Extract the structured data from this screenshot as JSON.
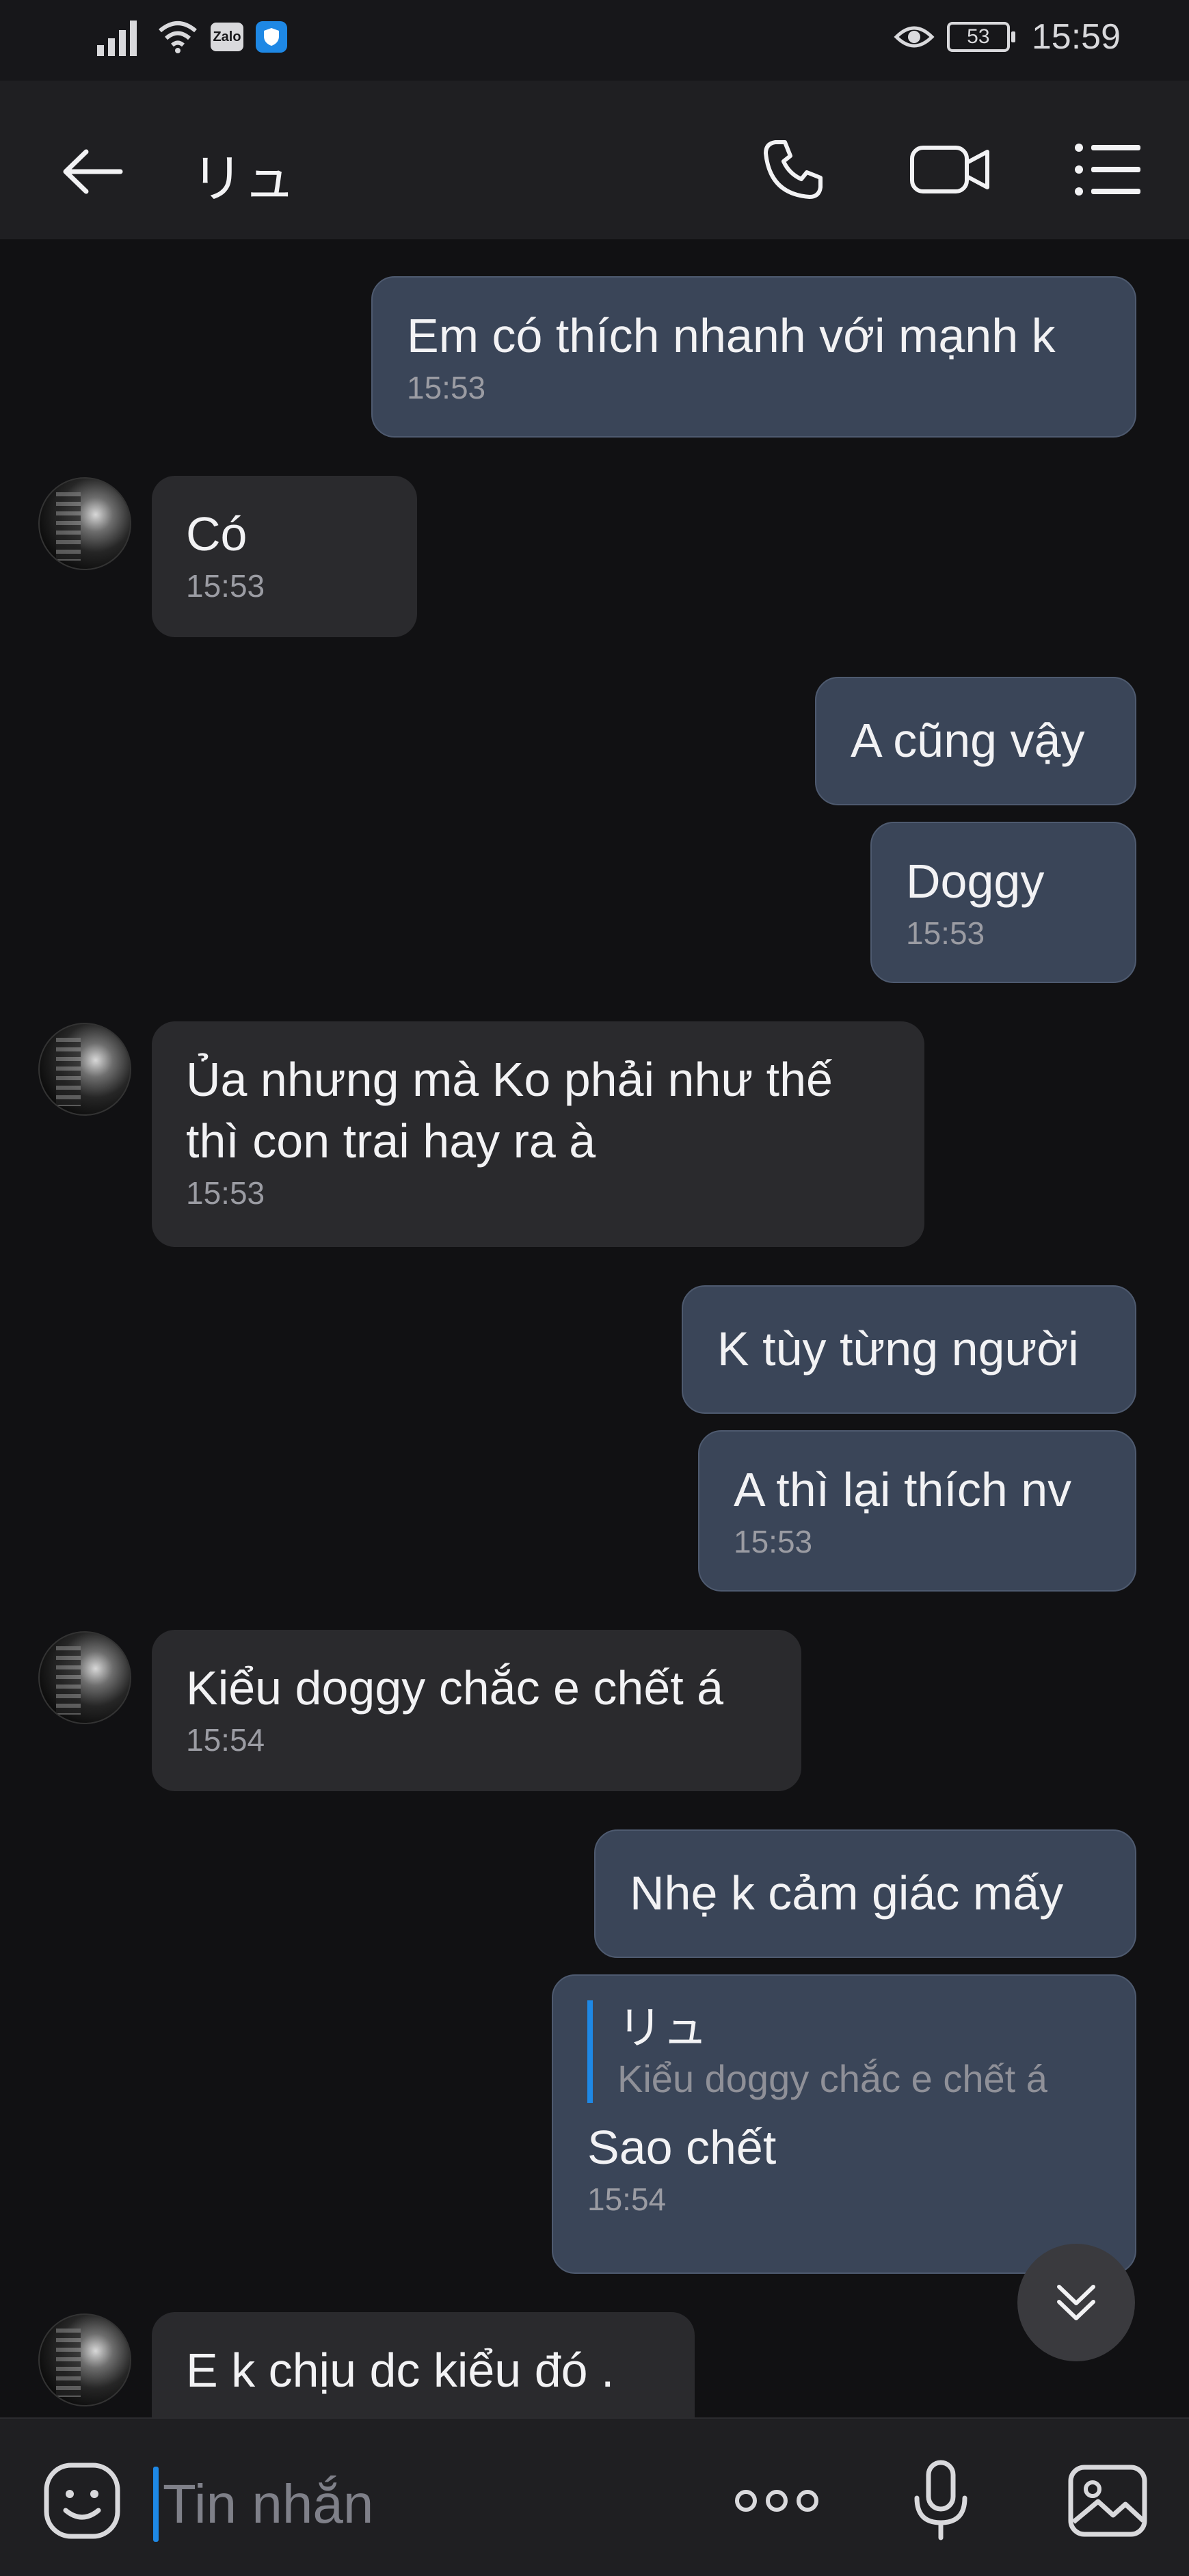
{
  "status_bar": {
    "zalo_label": "Zalo",
    "battery": "53",
    "time": "15:59"
  },
  "header": {
    "title": "リュ"
  },
  "messages": [
    {
      "side": "out",
      "text": "Em có thích nhanh với mạnh k",
      "time": "15:53"
    },
    {
      "side": "in",
      "text": "Có",
      "time": "15:53"
    },
    {
      "side": "out",
      "text": "A cũng vậy",
      "time": ""
    },
    {
      "side": "out",
      "text": "Doggy",
      "time": "15:53"
    },
    {
      "side": "in",
      "text_line1": "Ủa nhưng mà Ko phải như thế",
      "text_line2": "thì con trai hay ra à",
      "time": "15:53"
    },
    {
      "side": "out",
      "text": "K tùy từng người",
      "time": ""
    },
    {
      "side": "out",
      "text": "A thì lại thích nv",
      "time": "15:53"
    },
    {
      "side": "in",
      "text": "Kiểu doggy chắc e chết á",
      "time": "15:54"
    },
    {
      "side": "out",
      "text": "Nhẹ k cảm giác mấy",
      "time": ""
    },
    {
      "side": "out",
      "quote_name": "リュ",
      "quote_text": "Kiểu doggy chắc e chết á",
      "text": "Sao chết",
      "time": "15:54"
    },
    {
      "side": "in",
      "text": "E k chịu dc kiểu đó ."
    }
  ],
  "input": {
    "placeholder": "Tin nhắn"
  },
  "colors": {
    "background": "#111113",
    "outgoing_bubble": "#3a4558",
    "incoming_bubble": "#2a2a2d",
    "accent": "#1e88e5"
  }
}
